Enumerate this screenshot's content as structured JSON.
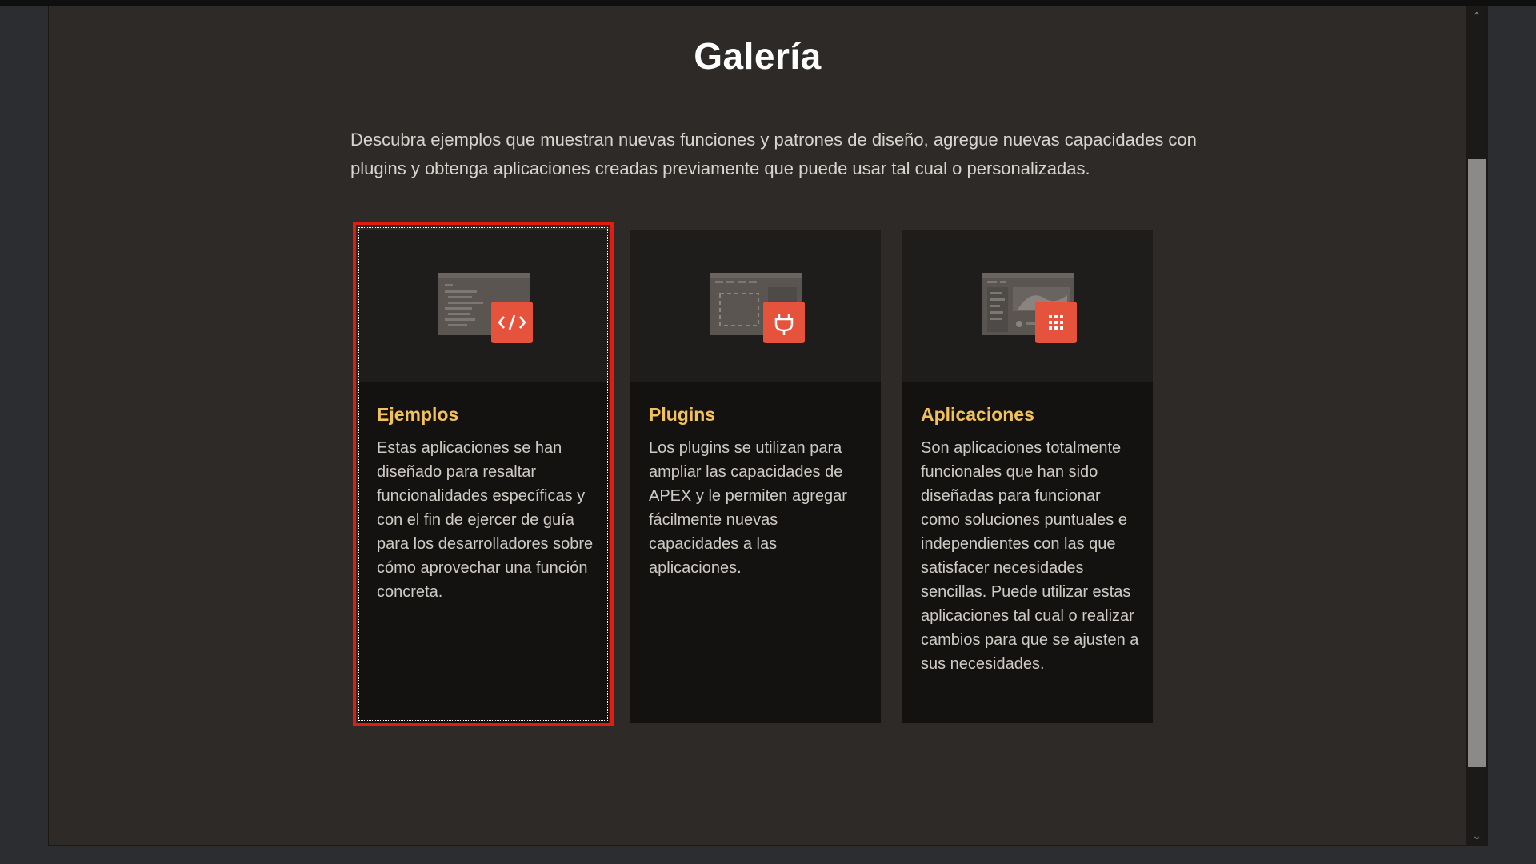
{
  "dialog": {
    "title": "Galería",
    "intro": "Descubra ejemplos que muestran nuevas funciones y patrones de diseño, agregue nuevas capacidades con plugins y obtenga aplicaciones creadas previamente que puede usar tal cual o personalizadas."
  },
  "cards": [
    {
      "title": "Ejemplos",
      "description": "Estas aplicaciones se han diseñado para resaltar funcionalidades específicas y con el fin de ejercer de guía para los desarrolladores sobre cómo aprovechar una función concreta.",
      "icon": "code-icon",
      "focused": true
    },
    {
      "title": "Plugins",
      "description": "Los plugins se utilizan para ampliar las capacidades de APEX y le permiten agregar fácilmente nuevas capacidades a las aplicaciones.",
      "icon": "plug-icon",
      "focused": false
    },
    {
      "title": "Aplicaciones",
      "description": "Son aplicaciones totalmente funcionales que han sido diseñadas para funcionar como soluciones puntuales e independientes con las que satisfacer necesidades sencillas. Puede utilizar estas aplicaciones tal cual o realizar cambios para que se ajusten a sus necesidades.",
      "icon": "grid-icon",
      "focused": false
    }
  ],
  "colors": {
    "accent": "#e5533d",
    "card_title": "#f3c15c",
    "focus": "#e11d12"
  }
}
